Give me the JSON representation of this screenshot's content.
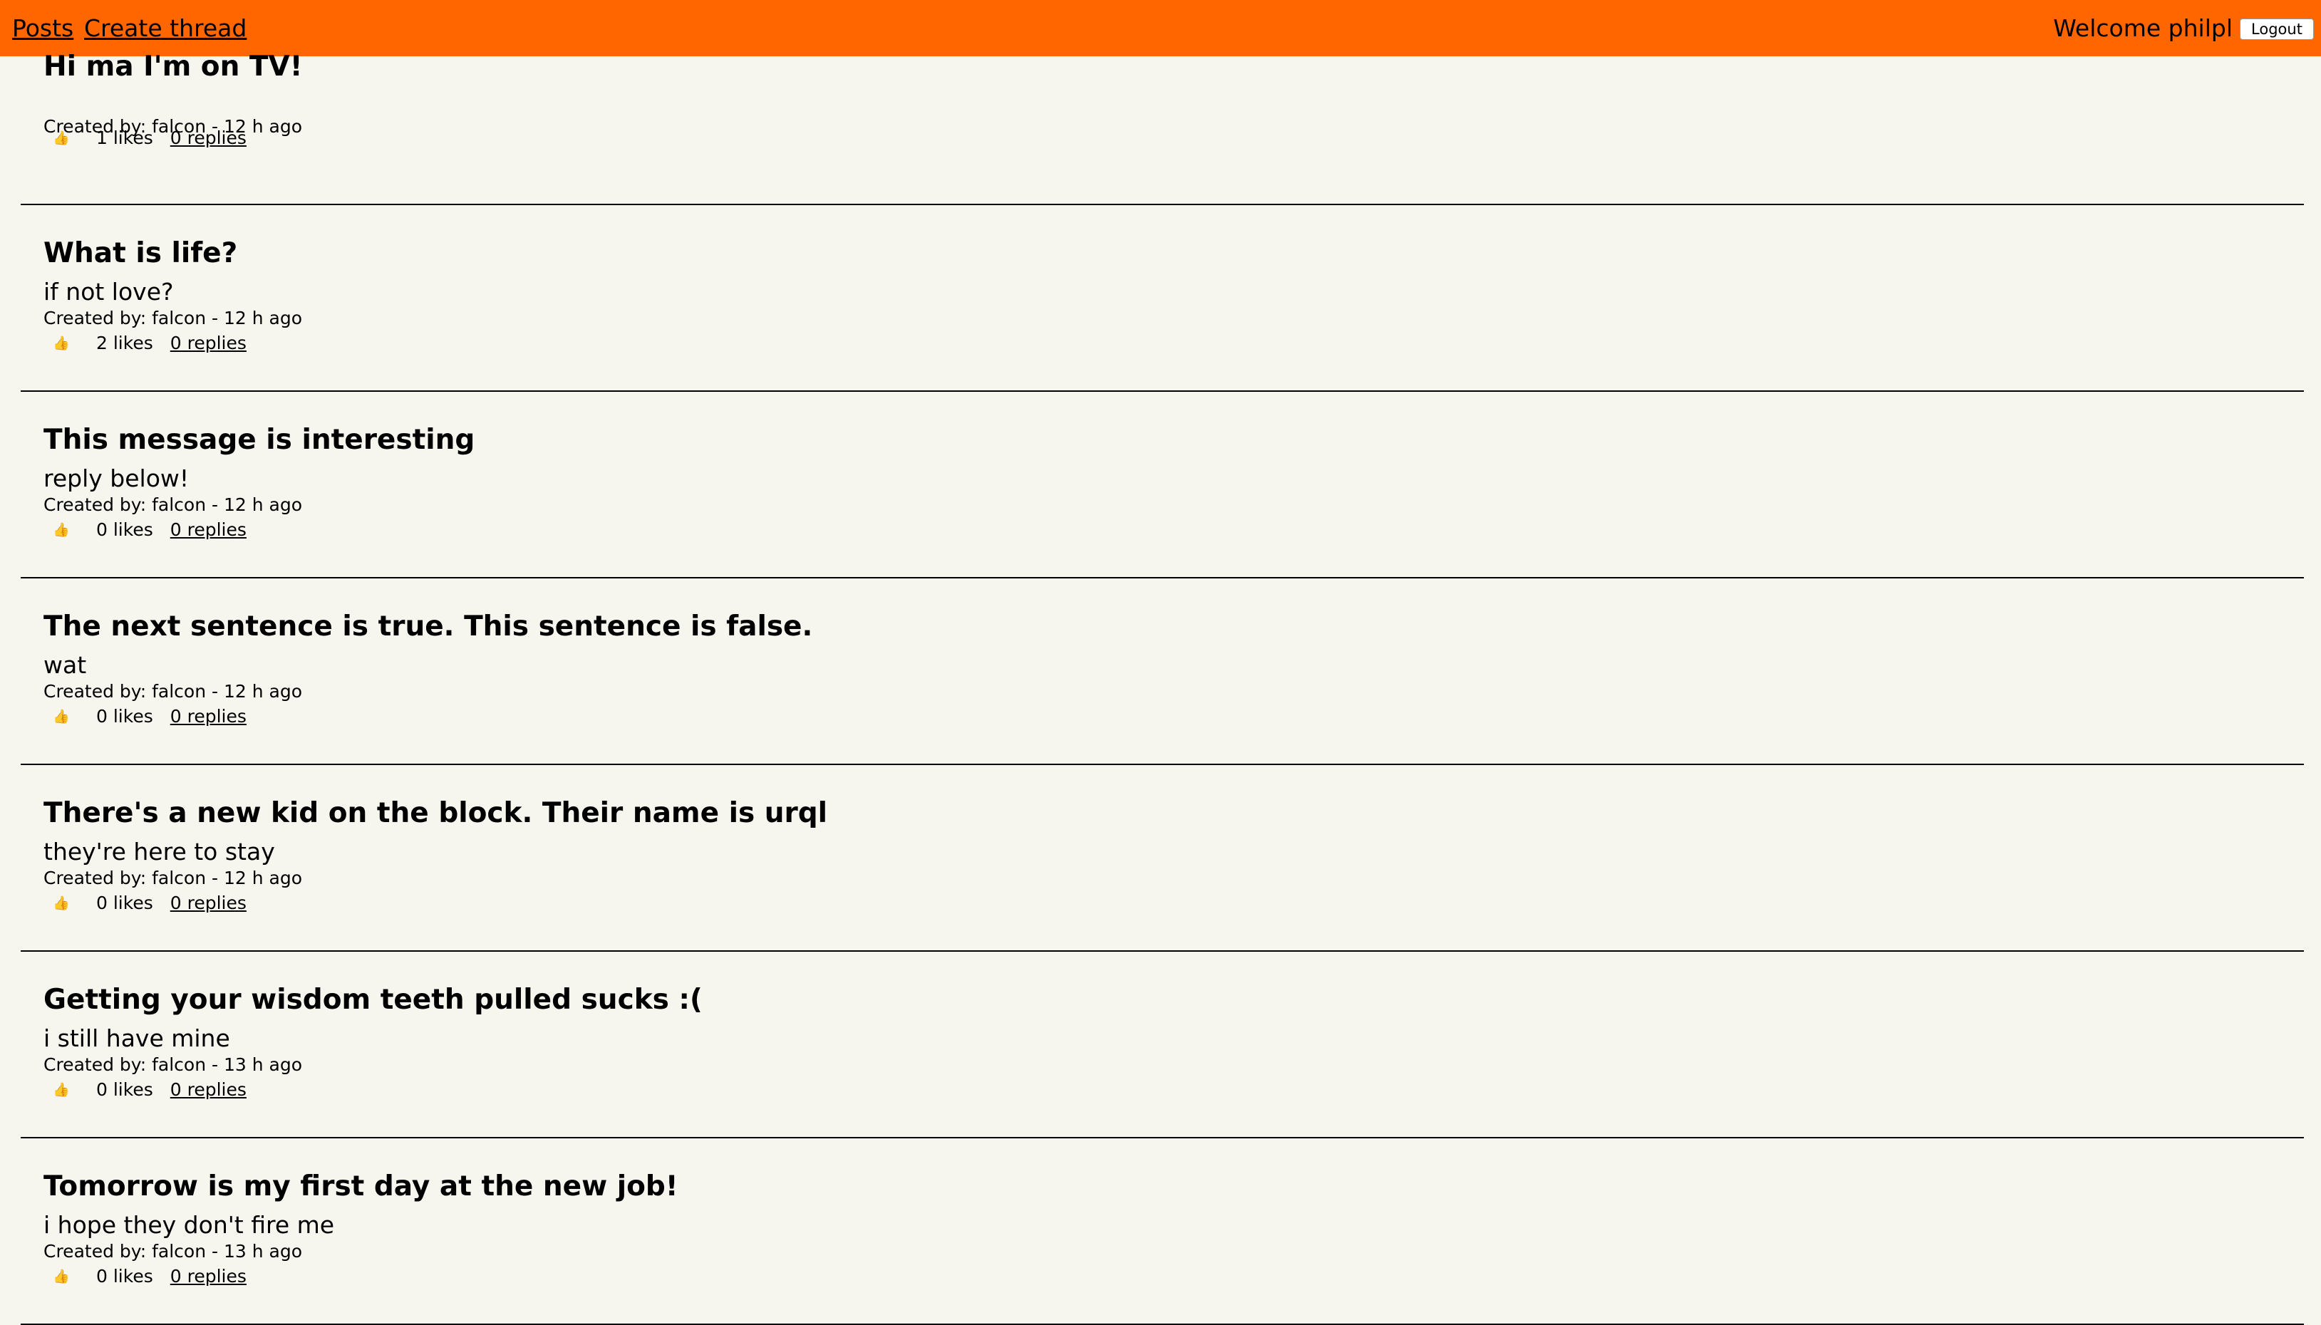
{
  "nav": {
    "posts_label": "Posts",
    "create_thread_label": "Create thread",
    "welcome_text": "Welcome philpl",
    "logout_label": "Logout"
  },
  "colors": {
    "header_bg": "#ff6600",
    "page_bg": "#f6f6ef"
  },
  "like_icon": "thumbs-up-icon",
  "posts": [
    {
      "title": "Hi ma I'm on TV!",
      "body": "",
      "meta": "Created by: falcon - 12 h ago",
      "likes": "1 likes",
      "replies": "0 replies"
    },
    {
      "title": "What is life?",
      "body": "if not love?",
      "meta": "Created by: falcon - 12 h ago",
      "likes": "2 likes",
      "replies": "0 replies"
    },
    {
      "title": "This message is interesting",
      "body": "reply below!",
      "meta": "Created by: falcon - 12 h ago",
      "likes": "0 likes",
      "replies": "0 replies"
    },
    {
      "title": "The next sentence is true. This sentence is false.",
      "body": "wat",
      "meta": "Created by: falcon - 12 h ago",
      "likes": "0 likes",
      "replies": "0 replies"
    },
    {
      "title": "There's a new kid on the block. Their name is urql",
      "body": "they're here to stay",
      "meta": "Created by: falcon - 12 h ago",
      "likes": "0 likes",
      "replies": "0 replies"
    },
    {
      "title": "Getting your wisdom teeth pulled sucks :(",
      "body": "i still have mine",
      "meta": "Created by: falcon - 13 h ago",
      "likes": "0 likes",
      "replies": "0 replies"
    },
    {
      "title": "Tomorrow is my first day at the new job!",
      "body": "i hope they don't fire me",
      "meta": "Created by: falcon - 13 h ago",
      "likes": "0 likes",
      "replies": "0 replies"
    }
  ]
}
